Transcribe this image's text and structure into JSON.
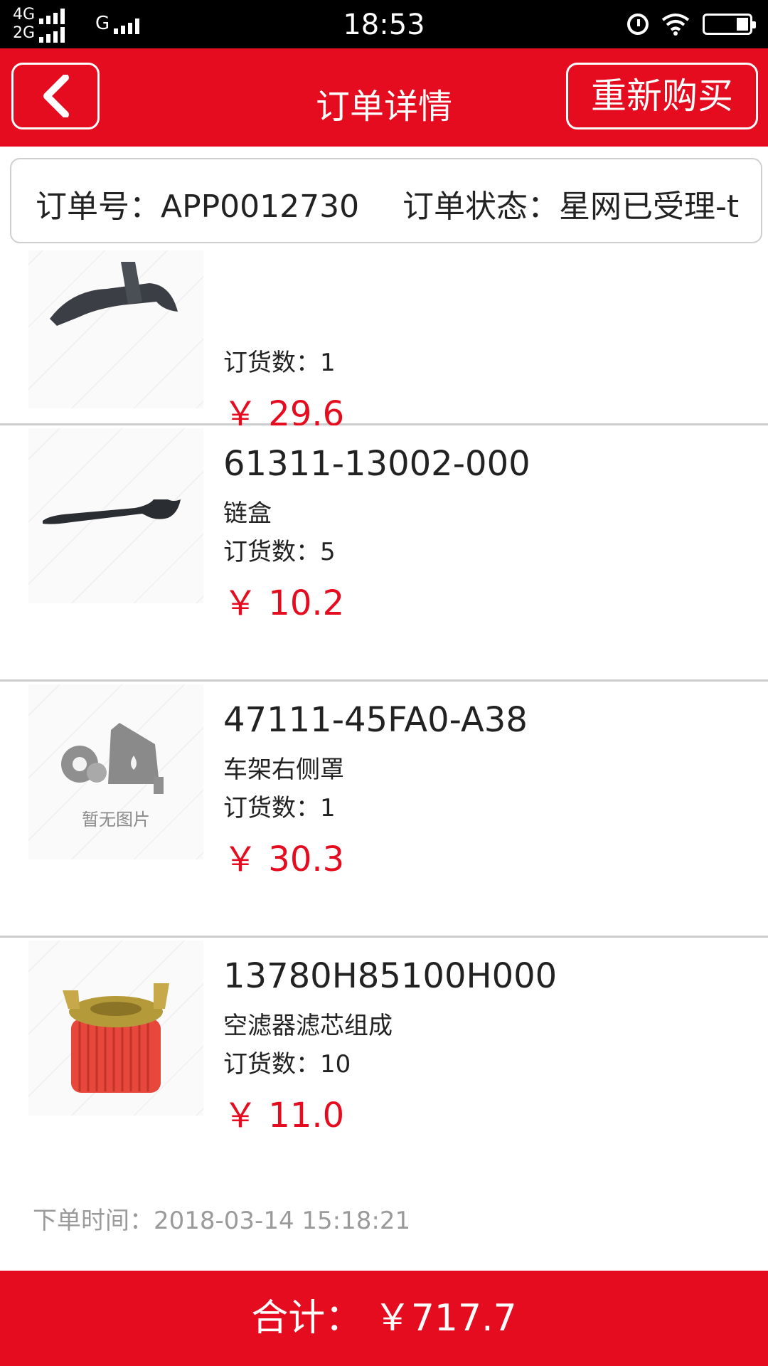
{
  "status_bar": {
    "network_top": "4G",
    "network_bottom": "2G",
    "network_g": "G",
    "time": "18:53"
  },
  "header": {
    "title": "订单详情",
    "rebuy_label": "重新购买",
    "accent_color": "#e60c1f"
  },
  "order": {
    "number_label": "订单号：",
    "number": "APP0012730",
    "status_label": "订单状态：",
    "status": "星网已受理-t"
  },
  "items": [
    {
      "part_no": "",
      "name": "",
      "qty_label": "订货数：",
      "qty": "1",
      "currency": "￥",
      "price": "29.6",
      "image": "cover-part-black"
    },
    {
      "part_no": "61311-13002-000",
      "name": "链盒",
      "qty_label": "订货数：",
      "qty": "5",
      "currency": "￥",
      "price": "10.2",
      "image": "chain-case"
    },
    {
      "part_no": "47111-45FA0-A38",
      "name": "车架右侧罩",
      "qty_label": "订货数：",
      "qty": "1",
      "currency": "￥",
      "price": "30.3",
      "image": "no-image",
      "no_image_text": "暂无图片"
    },
    {
      "part_no": "13780H85100H000",
      "name": "空滤器滤芯组成",
      "qty_label": "订货数：",
      "qty": "10",
      "currency": "￥",
      "price": "11.0",
      "image": "air-filter"
    }
  ],
  "order_time_label": "下单时间：",
  "order_time": "2018-03-14 15:18:21",
  "total": {
    "label": "合计：",
    "currency": "￥",
    "amount": "717.7"
  }
}
